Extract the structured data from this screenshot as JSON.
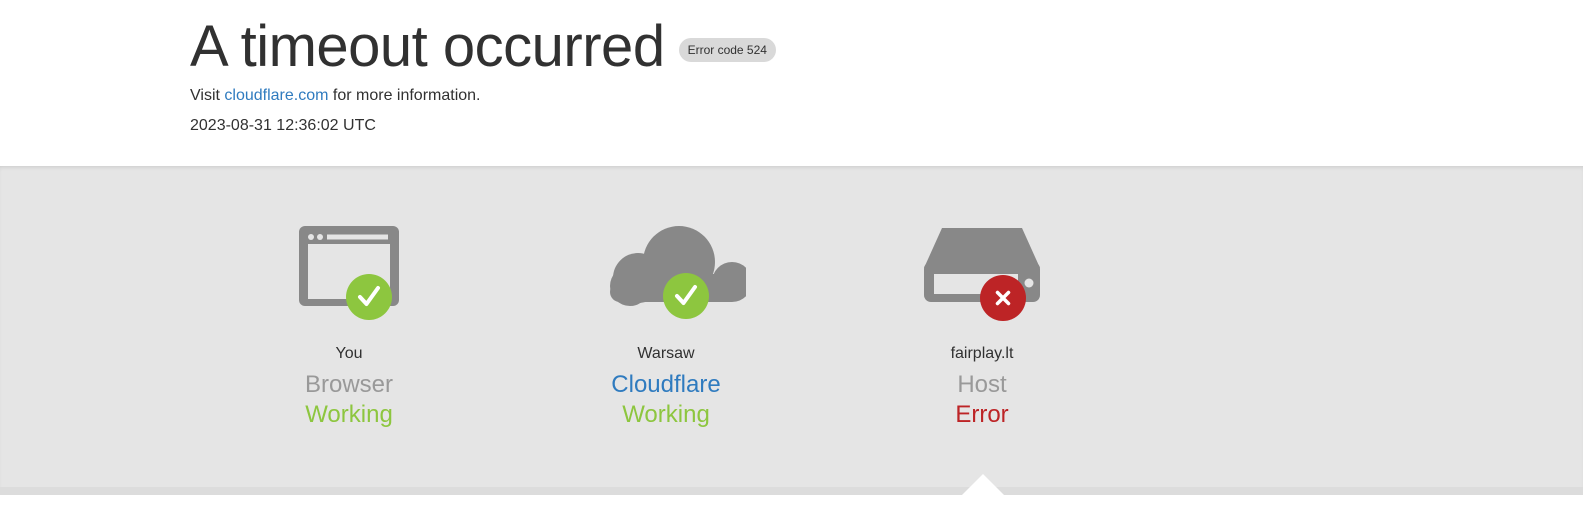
{
  "header": {
    "title": "A timeout occurred",
    "error_badge": "Error code 524",
    "visit_prefix": "Visit",
    "visit_link": "cloudflare.com",
    "visit_suffix": "for more information.",
    "timestamp": "2023-08-31 12:36:02 UTC"
  },
  "nodes": [
    {
      "icon": "browser-icon",
      "location": "You",
      "type": "Browser",
      "status": "Working",
      "state": "ok"
    },
    {
      "icon": "cloud-icon",
      "location": "Warsaw",
      "type": "Cloudflare",
      "status": "Working",
      "state": "ok"
    },
    {
      "icon": "server-icon",
      "location": "fairplay.lt",
      "type": "Host",
      "status": "Error",
      "state": "error"
    }
  ],
  "colors": {
    "ok": "#8dc63f",
    "error": "#bd2426",
    "link": "#2f7bbf",
    "icon_gray": "#888888",
    "band": "#e5e5e5"
  }
}
